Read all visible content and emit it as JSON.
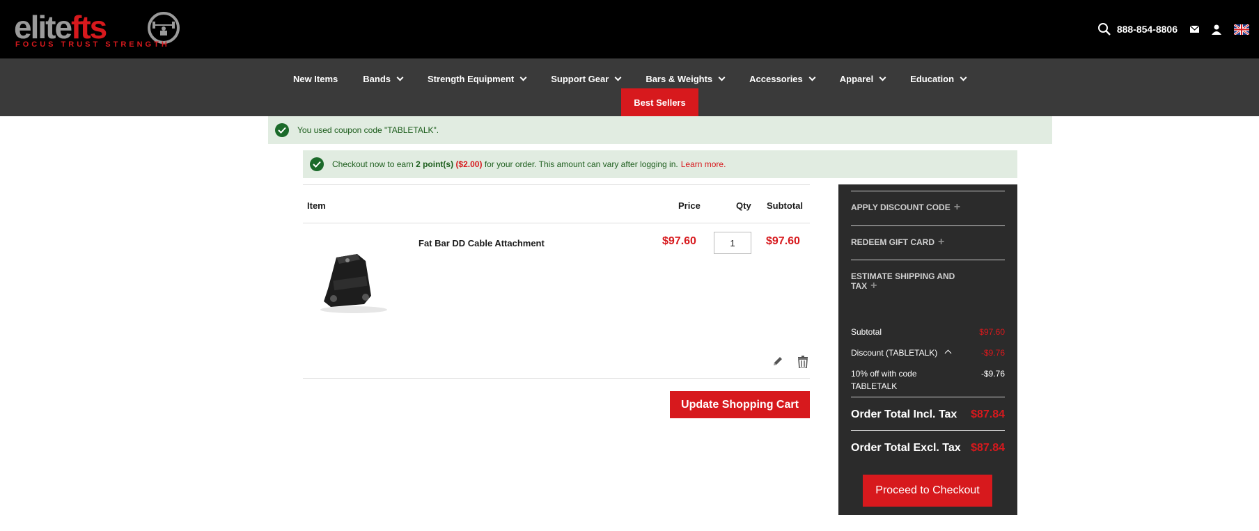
{
  "header": {
    "logo": {
      "part1": "elite",
      "part2": "fts",
      "tagline": "FOCUS   TRUST   STRENGTH"
    },
    "phone": "888-854-8806",
    "icons": [
      "search-icon",
      "mail-icon",
      "user-icon",
      "uk-flag-icon"
    ]
  },
  "nav": {
    "items": [
      {
        "label": "New Items",
        "dropdown": false
      },
      {
        "label": "Bands",
        "dropdown": true
      },
      {
        "label": "Strength Equipment",
        "dropdown": true
      },
      {
        "label": "Support Gear",
        "dropdown": true
      },
      {
        "label": "Bars & Weights",
        "dropdown": true
      },
      {
        "label": "Accessories",
        "dropdown": true
      },
      {
        "label": "Apparel",
        "dropdown": true
      },
      {
        "label": "Education",
        "dropdown": true
      }
    ],
    "best_sellers": "Best Sellers"
  },
  "messages": {
    "coupon": "You used coupon code \"TABLETALK\".",
    "points_prefix": "Checkout now to earn",
    "points_value": "2 point(s)",
    "points_money": "($2.00)",
    "points_suffix": "for your order. This amount can vary after logging in.",
    "learn_more": "Learn more."
  },
  "cart": {
    "columns": {
      "item": "Item",
      "price": "Price",
      "qty": "Qty",
      "subtotal": "Subtotal"
    },
    "items": [
      {
        "name": "Fat Bar DD Cable Attachment",
        "price": "$97.60",
        "qty": "1",
        "subtotal": "$97.60"
      }
    ],
    "update_label": "Update Shopping Cart"
  },
  "summary": {
    "apply_discount": "APPLY DISCOUNT CODE",
    "redeem_gift": "REDEEM GIFT CARD",
    "estimate_line1": "ESTIMATE SHIPPING AND",
    "estimate_line2": "TAX",
    "subtotal_label": "Subtotal",
    "subtotal_value": "$97.60",
    "discount_label": "Discount (TABLETALK)",
    "discount_value": "-$9.76",
    "discount_detail_line1": "10% off with code",
    "discount_detail_line2": "TABLETALK",
    "discount_detail_value": "-$9.76",
    "total_incl_label": "Order Total Incl. Tax",
    "total_incl_value": "$87.84",
    "total_excl_label": "Order Total Excl. Tax",
    "total_excl_value": "$87.84",
    "checkout_label": "Proceed to Checkout"
  },
  "colors": {
    "brand_red": "#d7191d",
    "nav_bg": "#3a3a3a",
    "sidebar_bg": "#2b2b2b",
    "success_bg": "#e1ece1"
  }
}
